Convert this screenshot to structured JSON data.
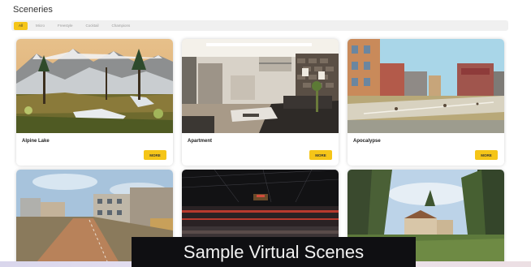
{
  "page": {
    "title": "Sceneries"
  },
  "filters": [
    {
      "label": "All",
      "active": true
    },
    {
      "label": "Micro",
      "active": false
    },
    {
      "label": "Freestyle",
      "active": false
    },
    {
      "label": "Cocktail",
      "active": false
    },
    {
      "label": "Champions",
      "active": false
    }
  ],
  "cards": [
    {
      "name": "Alpine Lake",
      "more_label": "MORE"
    },
    {
      "name": "Apartment",
      "more_label": "MORE"
    },
    {
      "name": "Apocalypse",
      "more_label": "MORE"
    }
  ],
  "caption": "Sample Virtual Scenes",
  "colors": {
    "accent": "#f5c518",
    "filter_bar": "#f0f0f0",
    "caption_bg": "#0f0f12"
  }
}
